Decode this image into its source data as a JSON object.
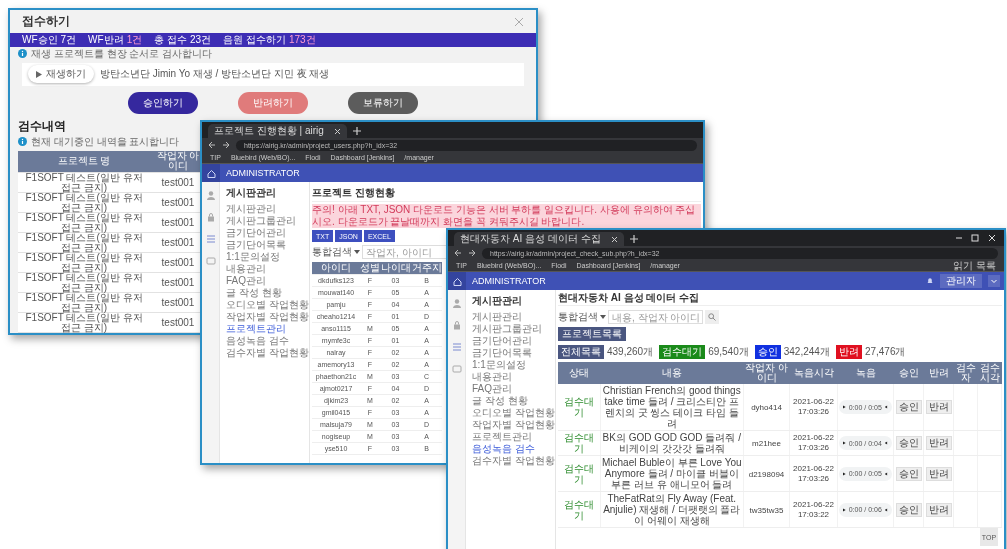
{
  "popup": {
    "title": "접수하기",
    "stats": [
      {
        "label": "WF승인",
        "value": "7건",
        "highlight": false
      },
      {
        "label": "WF반려",
        "value": "1건",
        "highlight": true
      },
      {
        "label": "총 접수",
        "value": "23건",
        "highlight": false
      },
      {
        "label": "음원 접수하기",
        "value": "173건",
        "highlight": true
      }
    ],
    "notice": "재생 프로젝트를 현장 순서로 검사합니다",
    "player": {
      "button": "재생하기",
      "text": "방탄소년단 Jimin Yo 재생 / 방탄소년단 지민 夜 재생"
    },
    "buttons": [
      {
        "label": "승인하기",
        "kind": "approve"
      },
      {
        "label": "반려하기",
        "kind": "reject"
      },
      {
        "label": "보류하기",
        "kind": "hold"
      }
    ],
    "history": {
      "title": "검수내역",
      "note": "현재 대기중인 내역을 표시합니다",
      "columns": [
        "프로젝트 명",
        "작업자 아이디"
      ],
      "rows": [
        [
          "F1SOFT 테스트(일반 유저 접근 금지)",
          "test001"
        ],
        [
          "F1SOFT 테스트(일반 유저 접근 금지)",
          "test001"
        ],
        [
          "F1SOFT 테스트(일반 유저 접근 금지)",
          "test001"
        ],
        [
          "F1SOFT 테스트(일반 유저 접근 금지)",
          "test001"
        ],
        [
          "F1SOFT 테스트(일반 유저 접근 금지)",
          "test001"
        ],
        [
          "F1SOFT 테스트(일반 유저 접근 금지)",
          "test001"
        ],
        [
          "F1SOFT 테스트(일반 유저 접근 금지)",
          "test001"
        ],
        [
          "F1SOFT 테스트(일반 유저 접근 금지)",
          "test001"
        ]
      ]
    }
  },
  "progress_window": {
    "tab": "프로젝트 진행현황 | airig",
    "url": "https://airig.kr/admin/project_users.php?h_idx=32",
    "bookmarks": [
      "TIP",
      "Bluebird (Web/BO)...",
      "Flodi",
      "Dashboard [Jenkins]",
      "/manager"
    ],
    "brand": "ADMINISTRATOR",
    "menu_title": "게시판관리",
    "menu": [
      {
        "label": "게시판관리",
        "selected": false
      },
      {
        "label": "게시판그룹관리",
        "selected": false
      },
      {
        "label": "금기단어관리",
        "selected": false
      },
      {
        "label": "금기단어목록",
        "selected": false
      },
      {
        "label": "1:1문의설정",
        "selected": false
      },
      {
        "label": "내용관리",
        "selected": false
      },
      {
        "label": "FAQ관리",
        "selected": false
      },
      {
        "label": "글 작성 현황",
        "selected": false
      },
      {
        "label": "오디오별 작업현황",
        "selected": false
      },
      {
        "label": "작업자별 작업현황",
        "selected": false
      },
      {
        "label": "프로젝트관리",
        "selected": true
      },
      {
        "label": "음성녹음 검수",
        "selected": false
      },
      {
        "label": "검수자별 작업현황",
        "selected": false
      }
    ],
    "title": "프로젝트 진행현황",
    "warning": "주의! 아래 TXT, JSON 다운로드 기능은 서버 부하를 일으킵니다. 사용에 유의하여 주십시오. 다운로드가 끝날때까지 화면을 꼭 켜둬주시길 바랍니다.",
    "download_buttons": [
      "TXT",
      "JSON",
      "EXCEL"
    ],
    "search": {
      "scope": "통합검색",
      "placeholder": "작업자, 아이디"
    },
    "table": {
      "columns": [
        "아이디",
        "성별",
        "나이대",
        "거주지"
      ],
      "rows": [
        [
          "dkdufks123",
          "F",
          "03",
          "B"
        ],
        [
          "mouwat140",
          "F",
          "05",
          "A"
        ],
        [
          "pamju",
          "F",
          "04",
          "A"
        ],
        [
          "cheaho1214",
          "F",
          "01",
          "D"
        ],
        [
          "anso1115",
          "M",
          "05",
          "A"
        ],
        [
          "mymfe3c",
          "F",
          "01",
          "A"
        ],
        [
          "nalray",
          "F",
          "02",
          "A"
        ],
        [
          "amemory13",
          "F",
          "02",
          "A"
        ],
        [
          "phaethon21c",
          "M",
          "03",
          "C"
        ],
        [
          "ajmot0217",
          "F",
          "04",
          "D"
        ],
        [
          "djkim23",
          "M",
          "02",
          "A"
        ],
        [
          "gmil0415",
          "F",
          "03",
          "A"
        ],
        [
          "malsuja79",
          "M",
          "03",
          "D"
        ],
        [
          "nogiseup",
          "M",
          "03",
          "A"
        ],
        [
          "yse510",
          "F",
          "03",
          "B"
        ]
      ]
    }
  },
  "review_window": {
    "tab": "현대자동차 AI 음성 데이터 수집",
    "url": "https://airig.kr/admin/project_check_sub.php?h_idx=32",
    "bookmarks": [
      "TIP",
      "Bluebird (Web/BO)...",
      "Flodi",
      "Dashboard [Jenkins]",
      "/manager"
    ],
    "reading_list": "읽기 목록",
    "brand": "ADMINISTRATOR",
    "user_button": "관리자",
    "menu_title": "게시판관리",
    "menu": [
      {
        "label": "게시판관리",
        "selected": false
      },
      {
        "label": "게시판그룹관리",
        "selected": false
      },
      {
        "label": "금기단어관리",
        "selected": false
      },
      {
        "label": "금기단어목록",
        "selected": false
      },
      {
        "label": "1:1문의설정",
        "selected": false
      },
      {
        "label": "내용관리",
        "selected": false
      },
      {
        "label": "FAQ관리",
        "selected": false
      },
      {
        "label": "글 작성 현황",
        "selected": false
      },
      {
        "label": "오디오별 작업현황",
        "selected": false
      },
      {
        "label": "작업자별 작업현황",
        "selected": false
      },
      {
        "label": "프로젝트관리",
        "selected": false
      },
      {
        "label": "음성녹음 검수",
        "selected": true
      },
      {
        "label": "검수자별 작업현황",
        "selected": false
      }
    ],
    "title": "현대자동차 AI 음성 데이터 수집",
    "search": {
      "scope": "통합검색",
      "placeholder": "내용, 작업자 아이디"
    },
    "project_list_button": "프로젝트목록",
    "counts": [
      {
        "label": "전체목록",
        "value": "439,260개",
        "color": "#4a5680"
      },
      {
        "label": "검수대기",
        "value": "69,540개",
        "color": "#1a8a1a"
      },
      {
        "label": "승인",
        "value": "342,244개",
        "color": "#1030e0"
      },
      {
        "label": "반려",
        "value": "27,476개",
        "color": "#e01020"
      }
    ],
    "table": {
      "columns": [
        "상태",
        "내용",
        "작업자 아이디",
        "녹음시각",
        "녹음",
        "승인",
        "반려",
        "검수자",
        "검수시각"
      ],
      "rows": [
        {
          "status": "검수대기",
          "content": "Christian French의 good things take time 들려 / 크리스티안 프렌치의 굿 씽스 테이크 타임 들려",
          "worker": "dyho414",
          "recorded_at": "2021-06-22 17:03:26",
          "duration": "0:00 / 0:05",
          "approve": "승인",
          "reject": "반려"
        },
        {
          "status": "검수대기",
          "content": "BK의 GOD GOD GOD 들려줘 / 비케이의 갓갓갓 들려줘",
          "worker": "m21hee",
          "recorded_at": "2021-06-22 17:03:26",
          "duration": "0:00 / 0:04",
          "approve": "승인",
          "reject": "반려"
        },
        {
          "status": "검수대기",
          "content": "Michael Buble이 부른 Love You Anymore 들려 / 마이클 버블이 부른 러브 유 애니모어 들려",
          "worker": "d2198094",
          "recorded_at": "2021-06-22 17:03:26",
          "duration": "0:00 / 0:05",
          "approve": "승인",
          "reject": "반려"
        },
        {
          "status": "검수대기",
          "content": "TheFatRat의 Fly Away (Feat. Anjulie) 재생해 / 더팻랫의 플라이 어웨이 재생해",
          "worker": "tw35tw35",
          "recorded_at": "2021-06-22 17:03:22",
          "duration": "0:00 / 0:06",
          "approve": "승인",
          "reject": "반려"
        }
      ]
    },
    "top_button": "TOP"
  }
}
